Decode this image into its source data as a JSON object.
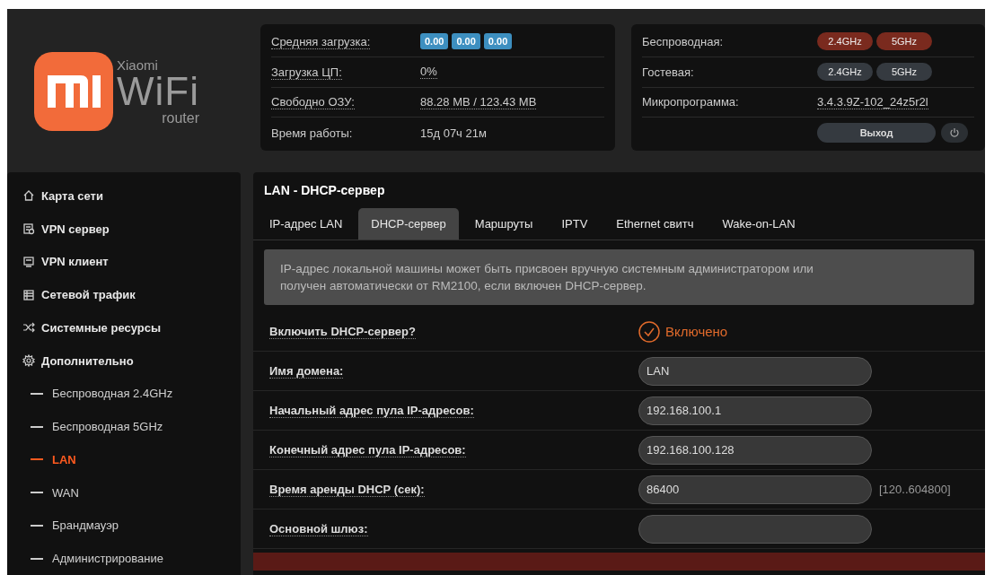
{
  "logo": {
    "brand": "Xiaomi",
    "product": "WiFi",
    "subtitle": "router"
  },
  "stats": {
    "rows": [
      {
        "label": "Средняя загрузка:",
        "kind": "badges",
        "badges": [
          "0.00",
          "0.00",
          "0.00"
        ]
      },
      {
        "label": "Загрузка ЦП:",
        "kind": "link",
        "value": "0%"
      },
      {
        "label": "Свободно ОЗУ:",
        "kind": "link",
        "value": "88.28 MB / 123.43 MB"
      },
      {
        "label": "Время работы:",
        "kind": "text",
        "value": "15д 07ч 21м"
      }
    ]
  },
  "radios": {
    "rows": [
      {
        "label": "Беспроводная:",
        "bands": [
          {
            "label": "2.4GHz",
            "on": true
          },
          {
            "label": "5GHz",
            "on": true
          }
        ]
      },
      {
        "label": "Гостевая:",
        "bands": [
          {
            "label": "2.4GHz",
            "on": false
          },
          {
            "label": "5GHz",
            "on": false
          }
        ]
      }
    ],
    "firmware_label": "Микропрограмма:",
    "firmware": "3.4.3.9Z-102_24z5r2l",
    "logout": "Выход"
  },
  "sidebar": {
    "items": [
      {
        "label": "Карта сети",
        "selected": false
      },
      {
        "label": "VPN сервер",
        "selected": false
      },
      {
        "label": "VPN клиент",
        "selected": false
      },
      {
        "label": "Сетевой трафик",
        "selected": false
      },
      {
        "label": "Системные ресурсы",
        "selected": false
      },
      {
        "label": "Дополнительно",
        "selected": false,
        "children": [
          {
            "label": "Беспроводная 2.4GHz",
            "selected": false
          },
          {
            "label": "Беспроводная 5GHz",
            "selected": false
          },
          {
            "label": "LAN",
            "selected": true
          },
          {
            "label": "WAN",
            "selected": false
          },
          {
            "label": "Брандмауэр",
            "selected": false
          },
          {
            "label": "Администрирование",
            "selected": false
          }
        ]
      }
    ]
  },
  "content": {
    "title": "LAN - DHCP-сервер",
    "tabs": [
      {
        "label": "IP-адрес LAN",
        "selected": false
      },
      {
        "label": "DHCP-сервер",
        "selected": true
      },
      {
        "label": "Маршруты",
        "selected": false
      },
      {
        "label": "IPTV",
        "selected": false
      },
      {
        "label": "Ethernet свитч",
        "selected": false
      },
      {
        "label": "Wake-on-LAN",
        "selected": false
      }
    ],
    "info": "IP-адрес локальной машины может быть присвоен вручную системным администратором или получен автоматически от RM2100, если включен DHCP-сервер.",
    "rows": [
      {
        "kind": "toggle",
        "label": "Включить DHCP-сервер?",
        "on": true,
        "value": "Включено"
      },
      {
        "kind": "input",
        "label": "Имя домена:",
        "value": "LAN"
      },
      {
        "kind": "input",
        "label": "Начальный адрес пула IP-адресов:",
        "value": "192.168.100.1"
      },
      {
        "kind": "input",
        "label": "Конечный адрес пула IP-адресов:",
        "value": "192.168.100.128"
      },
      {
        "kind": "input",
        "label": "Время аренды DHCP (сек):",
        "value": "86400",
        "hint": "[120..604800]"
      },
      {
        "kind": "input",
        "label": "Основной шлюз:"
      }
    ],
    "next_section": {
      "kind": "bar"
    }
  }
}
